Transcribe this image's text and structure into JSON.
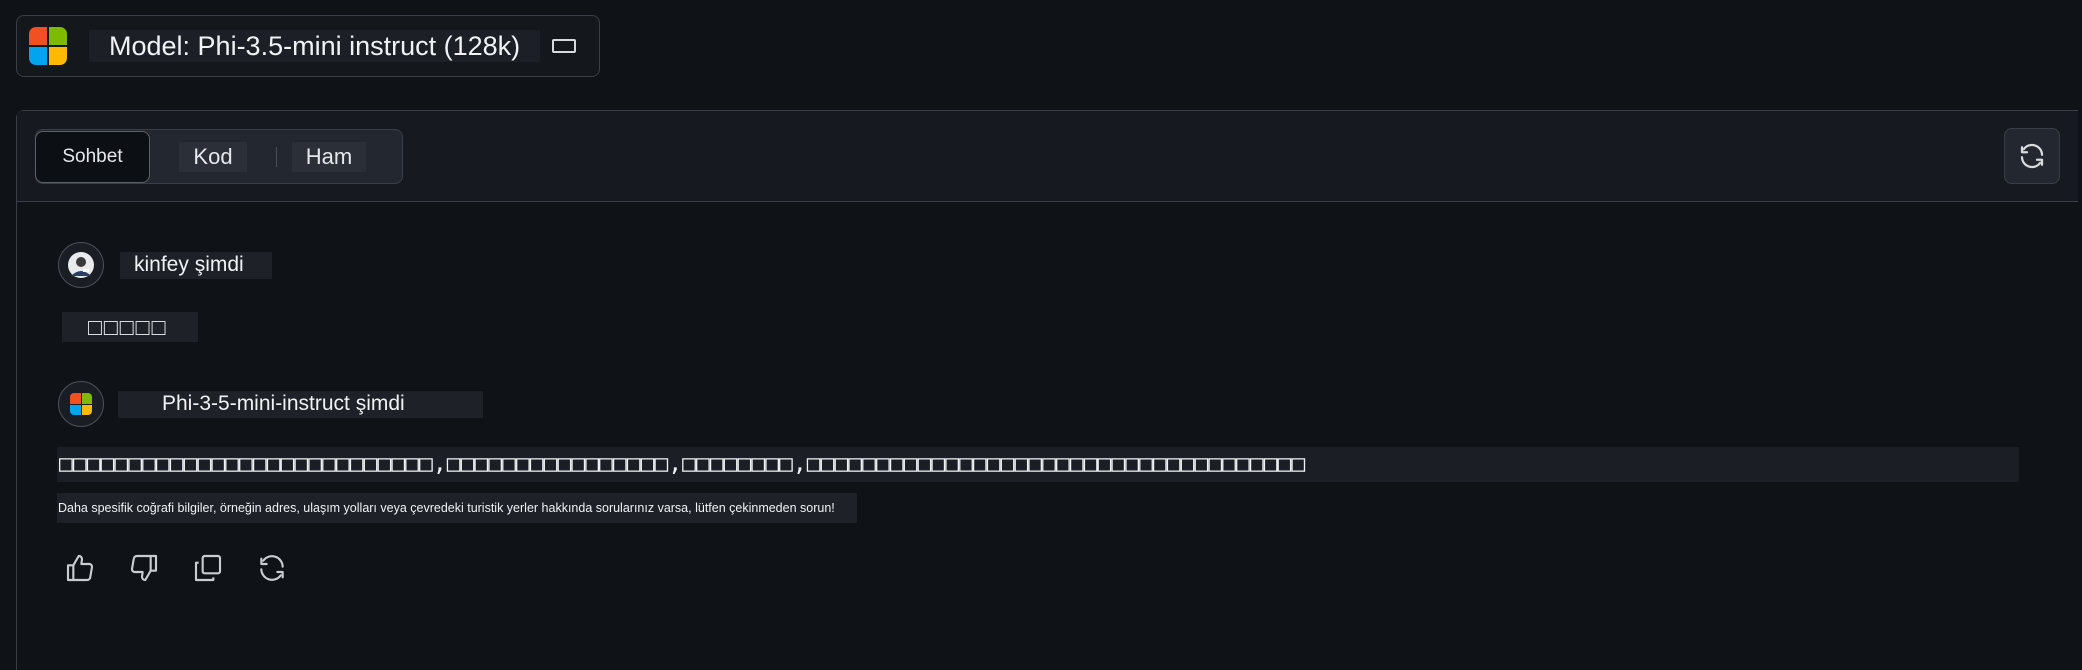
{
  "model_selector": {
    "label": "Model: Phi-3.5-mini instruct (128k)",
    "icon": "microsoft-logo",
    "toggle_icon": "panel-toggle-icon"
  },
  "tabs": [
    {
      "label": "Sohbet",
      "active": true
    },
    {
      "label": "Kod",
      "active": false
    },
    {
      "label": "Ham",
      "active": false
    }
  ],
  "conversation": {
    "user": {
      "name": "kinfey şimdi",
      "text": "□□□□□"
    },
    "assistant": {
      "name": "Phi-3-5-mini-instruct şimdi",
      "text": "□□□□□□□□□□□□□□□□□□□□□□□□□□□,□□□□□□□□□□□□□□□□,□□□□□□□□,□□□□□□□□□□□□□□□□□□□□□□□□□□□□□□□□□□□□",
      "subtext": "Daha spesifik coğrafi bilgiler, örneğin adres, ulaşım yolları veya çevredeki turistik yerler hakkında sorularınız varsa, lütfen çekinmeden sorun!"
    }
  },
  "actions": [
    "thumbs-up-icon",
    "thumbs-down-icon",
    "copy-icon",
    "regenerate-icon"
  ],
  "colors": {
    "background": "#0f1216",
    "panel_border": "#3a3f47",
    "ms_red": "#f25022",
    "ms_green": "#7fba00",
    "ms_blue": "#00a4ef",
    "ms_yellow": "#ffb900"
  }
}
